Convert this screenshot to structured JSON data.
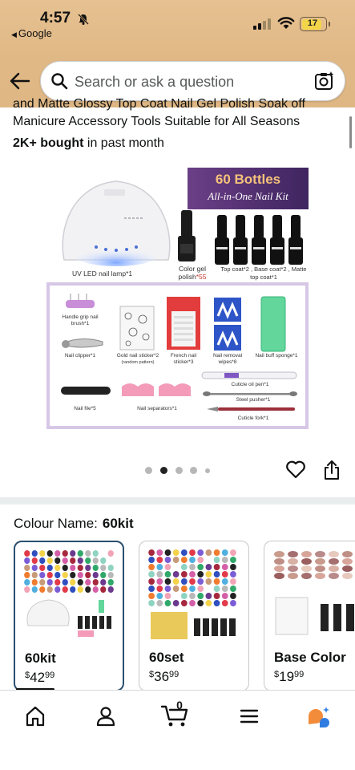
{
  "status_bar": {
    "time": "4:57",
    "back_app": "Google",
    "battery": "17"
  },
  "search": {
    "placeholder": "Search or ask a question"
  },
  "product": {
    "title_partial": "and Matte Glossy Top Coat Nail Gel Polish Soak off",
    "title_line": "Manicure Accessory Tools Suitable for All Seasons",
    "bought_count": "2K+ bought",
    "bought_suffix": "in past month"
  },
  "image": {
    "banner_title": "60 Bottles",
    "banner_subtitle": "All-in-One Nail Kit",
    "lamp_label": "UV LED nail lamp*1",
    "color_gel_label": "Color gel polish",
    "color_gel_count": "*55",
    "top_coat_label": "Top coat*2 , Base coat*2 , Matte top coat*1",
    "items": [
      "Handle grip nail brush*1",
      "Nail clipper*1",
      "Gold nail sticker*2",
      "(random pattern)",
      "French nail sticker*3",
      "Nail removal wipes*8",
      "Nail buff sponge*1",
      "Cuticle oil pen*1",
      "Steel pusher*1",
      "Cuticle fork*1",
      "Nail file*5",
      "Nail separators*1"
    ]
  },
  "carousel": {
    "total_dots": 5,
    "active_index": 1
  },
  "colour": {
    "label": "Colour Name:",
    "selected": "60kit"
  },
  "variants": [
    {
      "name": "60kit",
      "currency": "$",
      "price_whole": "42",
      "price_fraction": "99",
      "selected": true
    },
    {
      "name": "60set",
      "currency": "$",
      "price_whole": "36",
      "price_fraction": "99",
      "selected": false
    },
    {
      "name": "Base Color",
      "currency": "$",
      "price_whole": "19",
      "price_fraction": "99",
      "selected": false
    }
  ],
  "bottom_nav": {
    "cart_count": "0",
    "items": [
      "home-icon",
      "account-icon",
      "cart-icon",
      "menu-icon",
      "rufus-icon"
    ]
  },
  "colors": {
    "header_bg": "#e0b886",
    "selected_border": "#2a4f6e",
    "banner_purple": "#5a3476",
    "banner_gold": "#f5c27a",
    "rufus_orange": "#f28c3a",
    "rufus_blue": "#2f7de1"
  }
}
